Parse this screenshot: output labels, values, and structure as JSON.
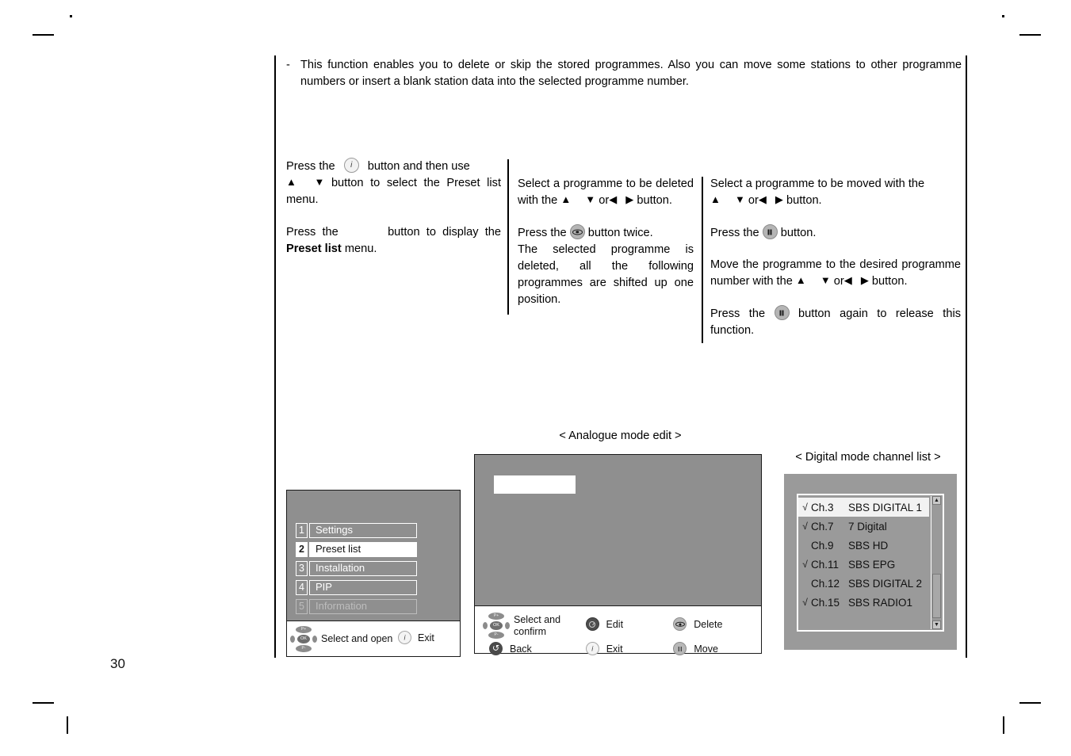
{
  "page": {
    "number": "30"
  },
  "intro": {
    "marker": "-",
    "text": "This function enables you to delete or skip the stored programmes. Also you can move some stations to other programme numbers or insert a blank station data into the selected programme number."
  },
  "columns": {
    "left": {
      "p1_a": "Press the",
      "p1_icon": "info-button-icon",
      "p1_b": "button and then use",
      "p1_arrow_up": "▲",
      "p1_arrow_down": "▼",
      "p1_c": "button to select the Preset list menu.",
      "p2_a": "Press the",
      "p2_icon": "blank-button-icon",
      "p2_b": "button to display the",
      "p2_bold": "Preset list",
      "p2_c": "menu."
    },
    "middle": {
      "p1_a": "Select a programme to be deleted with the",
      "p1_arrow_up": "▲",
      "p1_arrow_down": "▼",
      "p1_or": "or",
      "p1_arrow_left": "◀",
      "p1_arrow_right": "▶",
      "p1_b": "button.",
      "p2_a": "Press the",
      "p2_icon": "eye-delete-button-icon",
      "p2_b": "button twice.",
      "p3": "The selected programme is deleted, all the following programmes are shifted up one position."
    },
    "right": {
      "p1_a": "Select a programme to be moved with the",
      "p1_arrow_up": "▲",
      "p1_arrow_down": "▼",
      "p1_or": "or",
      "p1_arrow_left": "◀",
      "p1_arrow_right": "▶",
      "p1_b": "button.",
      "p2_a": "Press the",
      "p2_icon": "pause-move-button-icon",
      "p2_b": "button.",
      "p3_a": "Move the programme to the desired programme number with the",
      "p3_arrow_up": "▲",
      "p3_arrow_down": "▼",
      "p3_or": "or",
      "p3_arrow_left": "◀",
      "p3_arrow_right": "▶",
      "p3_b": "button.",
      "p4_a": "Press the",
      "p4_icon": "pause-move-button-icon",
      "p4_b": "button again to release this function."
    }
  },
  "menu_panel": {
    "items": [
      {
        "number": "1",
        "label": "Settings",
        "state": "normal"
      },
      {
        "number": "2",
        "label": "Preset list",
        "state": "selected"
      },
      {
        "number": "3",
        "label": "Installation",
        "state": "normal"
      },
      {
        "number": "4",
        "label": "PIP",
        "state": "normal"
      },
      {
        "number": "5",
        "label": "Information",
        "state": "dim"
      }
    ],
    "footer": {
      "nav_icon": "dpad-navigation-icon",
      "nav_pad_up": "P+",
      "nav_pad_ok": "OK",
      "nav_pad_down": "P-",
      "nav_label_line1": "Select",
      "nav_label_line2": "and open",
      "exit_icon": "info-button-icon",
      "exit_label": "Exit"
    }
  },
  "analogue_panel": {
    "caption": "< Analogue mode edit >",
    "footer": {
      "select_icon": "dpad-navigation-icon",
      "select_pad_up": "P+",
      "select_pad_ok": "OK",
      "select_pad_down": "P-",
      "select_label_line1": "Select",
      "select_label_line2": "and confirm",
      "back_icon": "back-arrow-icon",
      "back_label": "Back",
      "edit_icon": "edit-button-icon",
      "edit_label": "Edit",
      "exit_icon": "info-button-icon",
      "exit_label": "Exit",
      "delete_icon": "eye-delete-button-icon",
      "delete_label": "Delete",
      "move_icon": "pause-move-button-icon",
      "move_label": "Move"
    }
  },
  "digital_panel": {
    "caption": "< Digital mode channel list >",
    "scrollbar": {
      "up_arrow_icon": "scroll-up-arrow-icon",
      "down_arrow_icon": "scroll-down-arrow-icon"
    },
    "channels": [
      {
        "check": "√",
        "number": "Ch.3",
        "name": "SBS DIGITAL 1",
        "selected": true
      },
      {
        "check": "√",
        "number": "Ch.7",
        "name": "7 Digital",
        "selected": false
      },
      {
        "check": "",
        "number": "Ch.9",
        "name": "SBS HD",
        "selected": false
      },
      {
        "check": "√",
        "number": "Ch.11",
        "name": "SBS EPG",
        "selected": false
      },
      {
        "check": "",
        "number": "Ch.12",
        "name": "SBS DIGITAL 2",
        "selected": false
      },
      {
        "check": "√",
        "number": "Ch.15",
        "name": "SBS RADIO1",
        "selected": false
      }
    ]
  },
  "colors": {
    "osd_background": "#8f8f8f",
    "osd_background_digital": "#9a9a9a",
    "highlight": "#ffffff",
    "dim_text": "#bdbdbd",
    "text": "#000000"
  }
}
